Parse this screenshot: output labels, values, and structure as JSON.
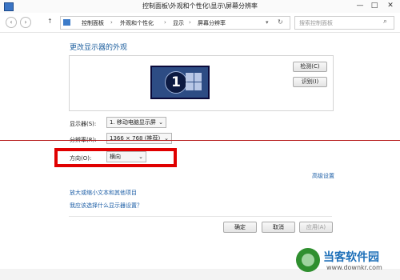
{
  "window": {
    "title": "控制面板\\外观和个性化\\显示\\屏幕分辨率",
    "minimize": "—",
    "maximize": "□",
    "close": "✕"
  },
  "nav": {
    "back": "‹",
    "forward": "›",
    "up": "↑",
    "breadcrumbs": [
      "控制面板",
      "外观和个性化",
      "显示",
      "屏幕分辨率"
    ],
    "refresh": "↻",
    "dropdown": "▾",
    "search_placeholder": "搜索控制面板",
    "search_icon": "⌕"
  },
  "page": {
    "title": "更改显示器的外观",
    "detect": "检测(C)",
    "identify": "识别(I)",
    "monitor_number": "1",
    "display_label": "显示器(S):",
    "display_value": "1. 移动电脑显示屏",
    "resolution_label": "分辨率(R):",
    "resolution_value": "1366 × 768 (推荐)",
    "orientation_label": "方向(O):",
    "orientation_value": "横向",
    "advanced": "高级设置",
    "link1": "放大或缩小文本和其他项目",
    "link2": "我应该选择什么显示器设置？",
    "ok": "确定",
    "cancel": "取消",
    "apply": "应用(A)"
  },
  "watermark": {
    "text": "当客软件园",
    "url": "www.downkr.com"
  },
  "colors": {
    "accent_link": "#1c5ea6",
    "highlight": "#e00000",
    "monitor": "#2d4c84"
  }
}
